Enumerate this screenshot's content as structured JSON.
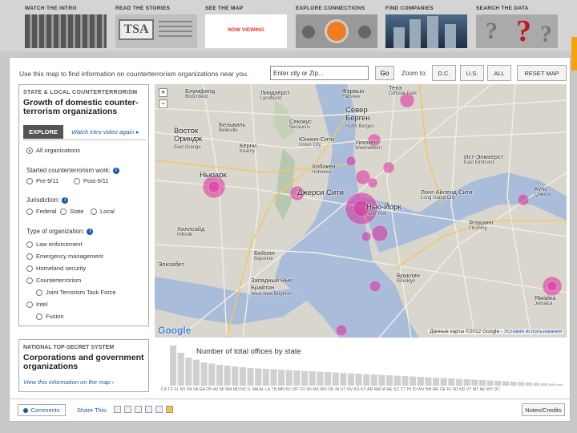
{
  "nav": {
    "items": [
      {
        "label": "WATCH THE INTRO"
      },
      {
        "label": "READ THE STORIES",
        "thumb_text": "TSA"
      },
      {
        "label": "SEE THE MAP",
        "thumb_text": "NOW VIEWING"
      },
      {
        "label": "EXPLORE CONNECTIONS"
      },
      {
        "label": "FIND COMPANIES"
      },
      {
        "label": "SEARCH THE DATA",
        "thumb_text": "?"
      }
    ]
  },
  "toolbar": {
    "instructions": "Use this map to find information on counterterrorism organizations near you.",
    "search_value": "Enter city or Zip...",
    "go_label": "Go",
    "zoom_label": "Zoom to:",
    "zoom_dc": "D.C.",
    "zoom_us": "U.S.",
    "zoom_all": "ALL",
    "reset_label": "RESET MAP"
  },
  "sidebar": {
    "kicker": "STATE & LOCAL COUNTERTERRORISM",
    "heading": "Growth of domestic counter-terrorism organizations",
    "explore_tab": "EXPLORE",
    "video_link": "Watch intro video again ▸",
    "all_orgs": "All organizations",
    "started_label": "Started counterterrorism work:",
    "pre911": "Pre-9/11",
    "post911": "Post-9/11",
    "jurisdiction_label": "Jurisdiction:",
    "federal": "Federal",
    "state": "State",
    "local": "Local",
    "type_label": "Type of organization:",
    "types": [
      "Law enforcement",
      "Emergency management",
      "Homeland security",
      "Counterterrorism"
    ],
    "jttf": "Joint Terrorism Task Force",
    "intel": "Intel",
    "fusion": "Fusion",
    "info_glyph": "i"
  },
  "natl": {
    "kicker": "NATIONAL TOP-SECRET SYSTEM",
    "heading": "Corporations and government organizations",
    "link": "View this information on the map ›"
  },
  "map": {
    "zoom_plus": "+",
    "zoom_minus": "−",
    "google": "Google",
    "credit": "Данные карты ©2012 Google - ",
    "credit_link": "Условия использования",
    "labels": [
      {
        "text": "Блумфилд",
        "sub": "Bloomfield"
      },
      {
        "text": "Линдхерст",
        "sub": "Lyndhurst"
      },
      {
        "text": "Фэрвью",
        "sub": "Fairview"
      },
      {
        "text": "Тенэ",
        "sub": "Cliffside Park"
      },
      {
        "text": "Север Берген",
        "sub": "North Bergen"
      },
      {
        "text": "Бельвиль",
        "sub": "Belleville"
      },
      {
        "text": "Секокус",
        "sub": "Secaucus"
      },
      {
        "text": "Юнион-Сити",
        "sub": "Union City"
      },
      {
        "text": "Восток Ориндж",
        "sub": "East Orange"
      },
      {
        "text": "Керни",
        "sub": "Kearny"
      },
      {
        "text": "Уихокен",
        "sub": "Weehawken"
      },
      {
        "text": "Ньюарк"
      },
      {
        "text": "Хобокен",
        "sub": "Hoboken"
      },
      {
        "text": "Джерси Сити"
      },
      {
        "text": "Нью-Йорк",
        "sub": "New York"
      },
      {
        "text": "Хиллсайд",
        "sub": "Hillside"
      },
      {
        "text": "Бейонн",
        "sub": "Bayonne"
      },
      {
        "text": "Бруклин",
        "sub": "Brooklyn"
      },
      {
        "text": "Элизабет"
      },
      {
        "text": "Западный Нью Брайтон",
        "sub": "West New Brighton"
      },
      {
        "text": "Лонг-Айленд-Сити",
        "sub": "Long Island City"
      },
      {
        "text": "Ист-Элмхерст",
        "sub": "East Elmhurst"
      },
      {
        "text": "Флашинг",
        "sub": "Flushing"
      },
      {
        "text": "Кунс",
        "sub": "Queens"
      },
      {
        "text": "Ямайка",
        "sub": "Jamaica"
      }
    ]
  },
  "chart_data": {
    "type": "bar",
    "title": "Number of total offices by state",
    "values": [
      100,
      82,
      70,
      65,
      58,
      55,
      52,
      50,
      48,
      46,
      44,
      43,
      42,
      41,
      40,
      39,
      38,
      37,
      36,
      35,
      34,
      33,
      32,
      31,
      30,
      29,
      28,
      27,
      26,
      25,
      24,
      23,
      22,
      21,
      20,
      19,
      18,
      17,
      16,
      15,
      14,
      13,
      12,
      11,
      10,
      9,
      8,
      7,
      6,
      5,
      4
    ],
    "xtick_text": "CA TX FL NY PA VA GA OH AZ MI WA MD NC IL MA AL LA TN MN NJ OR CO WI MS MO OK IN UT NV KS KY AR NM IA NE SC CT HI ID WV NH ME DE RI SD ND VT MT AK WY DC"
  },
  "footer": {
    "comments": "Comments",
    "share": "Share This:",
    "notes": "Notes/Credits"
  }
}
